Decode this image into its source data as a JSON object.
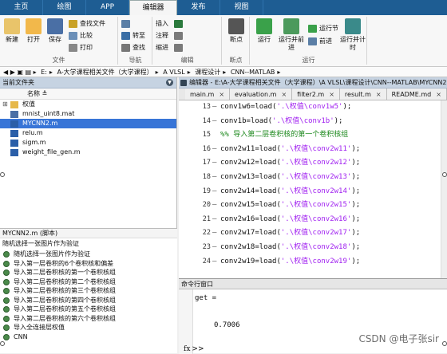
{
  "tabs": [
    "主页",
    "绘图",
    "APP",
    "编辑器",
    "发布",
    "视图"
  ],
  "ribbon": {
    "file_group": {
      "new": "新建",
      "open": "打开",
      "save": "保存",
      "find_files": "查找文件",
      "compare": "比较",
      "print": "打印",
      "label": "文件"
    },
    "nav_group": {
      "go_to": "转至",
      "find": "查找",
      "label": "导航"
    },
    "edit_group": {
      "insert": "插入",
      "comment": "注释",
      "indent": "缩进",
      "label": "编辑"
    },
    "breakpoint_group": {
      "breakpoint": "断点",
      "label": "断点"
    },
    "run_group": {
      "run": "运行",
      "run_advance": "运行并前进",
      "run_section": "运行节",
      "advance": "前进",
      "run_time": "运行并计时",
      "label": "运行"
    }
  },
  "address": {
    "parts": [
      "E:",
      "A-大学课程相关文件（大学课程）",
      "A VLSL",
      "课程设计",
      "CNN--MATLAB"
    ]
  },
  "current_folder": {
    "title": "当前文件夹",
    "column_header": "名称",
    "items": [
      {
        "name": "权值",
        "type": "folder",
        "selected": false
      },
      {
        "name": "mnist_uint8.mat",
        "type": "mat",
        "selected": false
      },
      {
        "name": "MYCNN2.m",
        "type": "m",
        "selected": true
      },
      {
        "name": "relu.m",
        "type": "m",
        "selected": false
      },
      {
        "name": "sigm.m",
        "type": "m",
        "selected": false
      },
      {
        "name": "weight_file_gen.m",
        "type": "m",
        "selected": false
      }
    ]
  },
  "details": {
    "header": "MYCNN2.m (脚本)",
    "title": "随机选择一张图片作为验证",
    "items": [
      "随机选择一张图片作为验证",
      "导入第一层卷积的6个卷积核和偏差",
      "导入第二层卷积核的第一个卷积核组",
      "导入第二层卷积核的第二个卷积核组",
      "导入第二层卷积核的第三个卷积核组",
      "导入第二层卷积核的第四个卷积核组",
      "导入第二层卷积核的第五个卷积核组",
      "导入第二层卷积核的第六个卷积核组",
      "导入全连接层权值",
      "CNN"
    ]
  },
  "editor": {
    "title": "编辑器 - E:\\A-大学课程相关文件（大学课程）\\A VLSL\\课程设计\\CNN--MATLAB\\MYCNN2.m",
    "tabs": [
      {
        "label": "main.m",
        "active": false
      },
      {
        "label": "evaluation.m",
        "active": false
      },
      {
        "label": "filter2.m",
        "active": false
      },
      {
        "label": "result.m",
        "active": false
      },
      {
        "label": "README.md",
        "active": false
      }
    ],
    "lines": [
      {
        "num": "13",
        "dash": true,
        "pre": "conv1w6=load(",
        "str": "'.\\权值\\conv1w5'",
        "post": ");",
        "comment": ""
      },
      {
        "num": "14",
        "dash": true,
        "pre": "conv1b=load(",
        "str": "'.\\权值\\conv1b'",
        "post": ");",
        "comment": ""
      },
      {
        "num": "15",
        "dash": false,
        "pre": "",
        "str": "",
        "post": "",
        "comment": "%% 导入第二层卷积核的第一个卷积核组"
      },
      {
        "num": "16",
        "dash": true,
        "pre": "conv2w11=load(",
        "str": "'.\\权值\\conv2w11'",
        "post": ");",
        "comment": ""
      },
      {
        "num": "17",
        "dash": true,
        "pre": "conv2w12=load(",
        "str": "'.\\权值\\conv2w12'",
        "post": ");",
        "comment": ""
      },
      {
        "num": "18",
        "dash": true,
        "pre": "conv2w13=load(",
        "str": "'.\\权值\\conv2w13'",
        "post": ");",
        "comment": ""
      },
      {
        "num": "19",
        "dash": true,
        "pre": "conv2w14=load(",
        "str": "'.\\权值\\conv2w14'",
        "post": ");",
        "comment": ""
      },
      {
        "num": "20",
        "dash": true,
        "pre": "conv2w15=load(",
        "str": "'.\\权值\\conv2w15'",
        "post": ");",
        "comment": ""
      },
      {
        "num": "21",
        "dash": true,
        "pre": "conv2w16=load(",
        "str": "'.\\权值\\conv2w16'",
        "post": ");",
        "comment": ""
      },
      {
        "num": "22",
        "dash": true,
        "pre": "conv2w17=load(",
        "str": "'.\\权值\\conv2w17'",
        "post": ");",
        "comment": ""
      },
      {
        "num": "23",
        "dash": true,
        "pre": "conv2w18=load(",
        "str": "'.\\权值\\conv2w18'",
        "post": ");",
        "comment": ""
      },
      {
        "num": "24",
        "dash": true,
        "pre": "conv2w19=load(",
        "str": "'.\\权值\\conv2w19'",
        "post": ");",
        "comment": ""
      }
    ]
  },
  "command_window": {
    "title": "命令行窗口",
    "line1": "get =",
    "line2": "0.7006",
    "prompt_symbol": "fx",
    "prompt": ">>"
  },
  "watermark": "CSDN @电子张sir",
  "colors": {
    "tab_bar": "#1e5d93",
    "selection": "#3875d7",
    "string": "#a020f0",
    "comment": "#228b22"
  }
}
